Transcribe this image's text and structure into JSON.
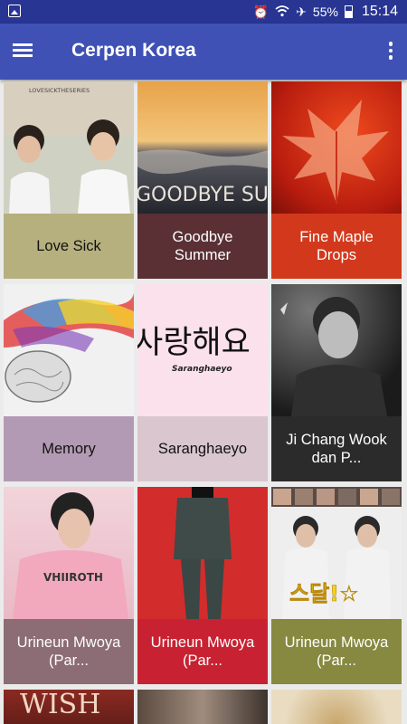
{
  "status_bar": {
    "battery_percent": "55%",
    "time": "15:14",
    "icons": [
      "image-icon",
      "alarm-icon",
      "wifi-icon",
      "airplane-icon",
      "battery-icon"
    ]
  },
  "app_bar": {
    "title": "Cerpen Korea",
    "menu_icon": "hamburger-menu-icon",
    "overflow_icon": "more-vert-icon"
  },
  "stories": [
    {
      "title": "Love Sick",
      "caption_color": "#b5b07e",
      "text_color": "#111111",
      "thumb_text": "LOVESICKTHESERIES"
    },
    {
      "title": "Goodbye Summer",
      "caption_color": "#5a3034",
      "text_color": "#ffffff",
      "thumb_text": "GOODBYE SUMME"
    },
    {
      "title": "Fine Maple Drops",
      "caption_color": "#d2391c",
      "text_color": "#ffffff",
      "thumb_text": ""
    },
    {
      "title": "Memory",
      "caption_color": "#b39ab4",
      "text_color": "#111111",
      "thumb_text": ""
    },
    {
      "title": "Saranghaeyo",
      "caption_color": "#d9c6cf",
      "text_color": "#111111",
      "thumb_text": "사랑해요",
      "thumb_subtext": "Saranghaeyo"
    },
    {
      "title": "Ji Chang Wook dan P...",
      "caption_color": "#2b2b2b",
      "text_color": "#ffffff",
      "thumb_text": ""
    },
    {
      "title": "Urineun Mwoya (Par...",
      "caption_color": "#8c6c75",
      "text_color": "#ffffff",
      "thumb_text": "VHIIROTH"
    },
    {
      "title": "Urineun Mwoya (Par...",
      "caption_color": "#c82232",
      "text_color": "#ffffff",
      "thumb_text": ""
    },
    {
      "title": "Urineun Mwoya (Par...",
      "caption_color": "#86893f",
      "text_color": "#ffffff",
      "thumb_text": "스달!☆"
    },
    {
      "title": "",
      "caption_color": "#5a2420",
      "text_color": "#ffffff",
      "thumb_text": "WISH"
    },
    {
      "title": "",
      "caption_color": "#6b5a4e",
      "text_color": "#ffffff",
      "thumb_text": ""
    },
    {
      "title": "",
      "caption_color": "#d8c9a4",
      "text_color": "#111111",
      "thumb_text": ""
    }
  ]
}
